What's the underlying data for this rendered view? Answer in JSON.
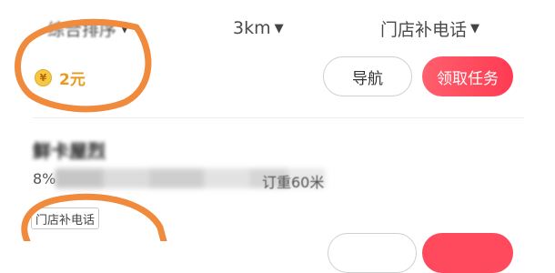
{
  "filters": [
    {
      "label": "综合排序",
      "icon": "caret-down-icon"
    },
    {
      "label": "3km",
      "icon": "caret-down-icon"
    },
    {
      "label": "门店补电话",
      "icon": "caret-down-icon"
    }
  ],
  "caret_glyph": "▼",
  "task": {
    "coin_symbol": "¥",
    "reward": "2元",
    "nav_button": "导航",
    "claim_button": "领取任务"
  },
  "store": {
    "name": "鲜卡屋烈",
    "distance_prefix": "8%",
    "distance_suffix": "订重60米",
    "tag": "门店补电话"
  },
  "colors": {
    "accent": "#ff3b53",
    "reward": "#e79b1c",
    "annotation": "#f08a3c"
  }
}
